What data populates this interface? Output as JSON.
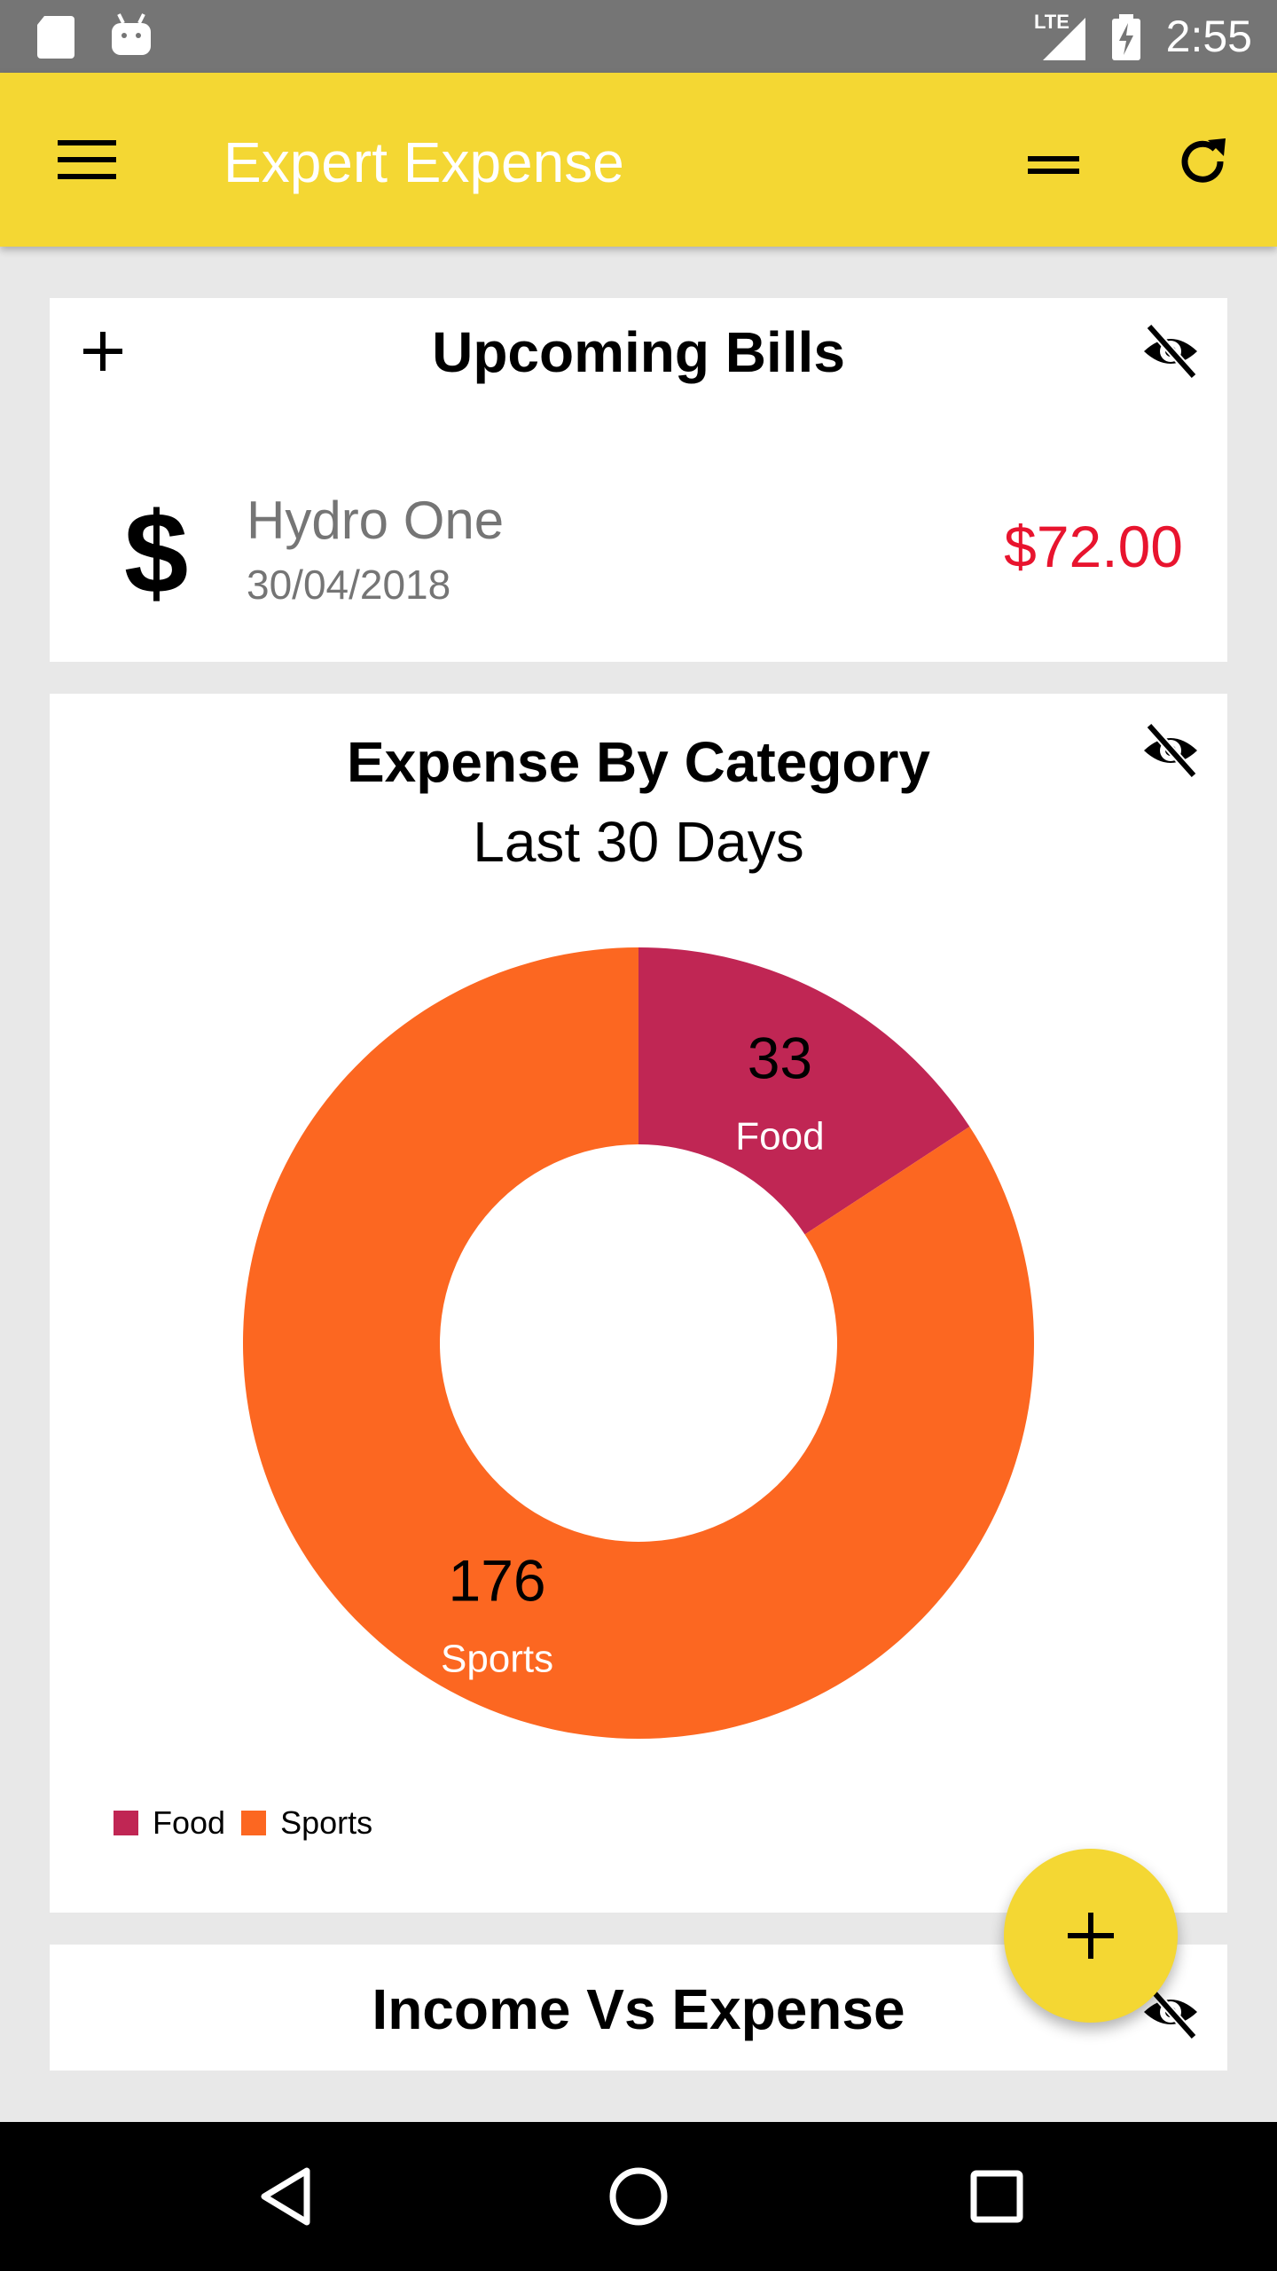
{
  "status_bar": {
    "time": "2:55",
    "network": "LTE"
  },
  "app_bar": {
    "title": "Expert Expense"
  },
  "upcoming_bills": {
    "title": "Upcoming Bills",
    "bills": [
      {
        "icon": "$",
        "name": "Hydro One",
        "date": "30/04/2018",
        "amount": "$72.00"
      }
    ]
  },
  "expense_by_category": {
    "title": "Expense By Category",
    "subtitle": "Last 30 Days"
  },
  "income_vs_expense": {
    "title": "Income Vs Expense"
  },
  "colors": {
    "accent": "#f4d733",
    "food": "#c02654",
    "sports": "#fc6721",
    "amount_red": "#e8142e"
  },
  "chart_data": {
    "type": "pie",
    "title": "Expense By Category",
    "subtitle": "Last 30 Days",
    "donut": true,
    "categories": [
      "Food",
      "Sports"
    ],
    "values": [
      33,
      176
    ],
    "colors": [
      "#c02654",
      "#fc6721"
    ],
    "legend": "bottom-left",
    "show_values": true
  }
}
